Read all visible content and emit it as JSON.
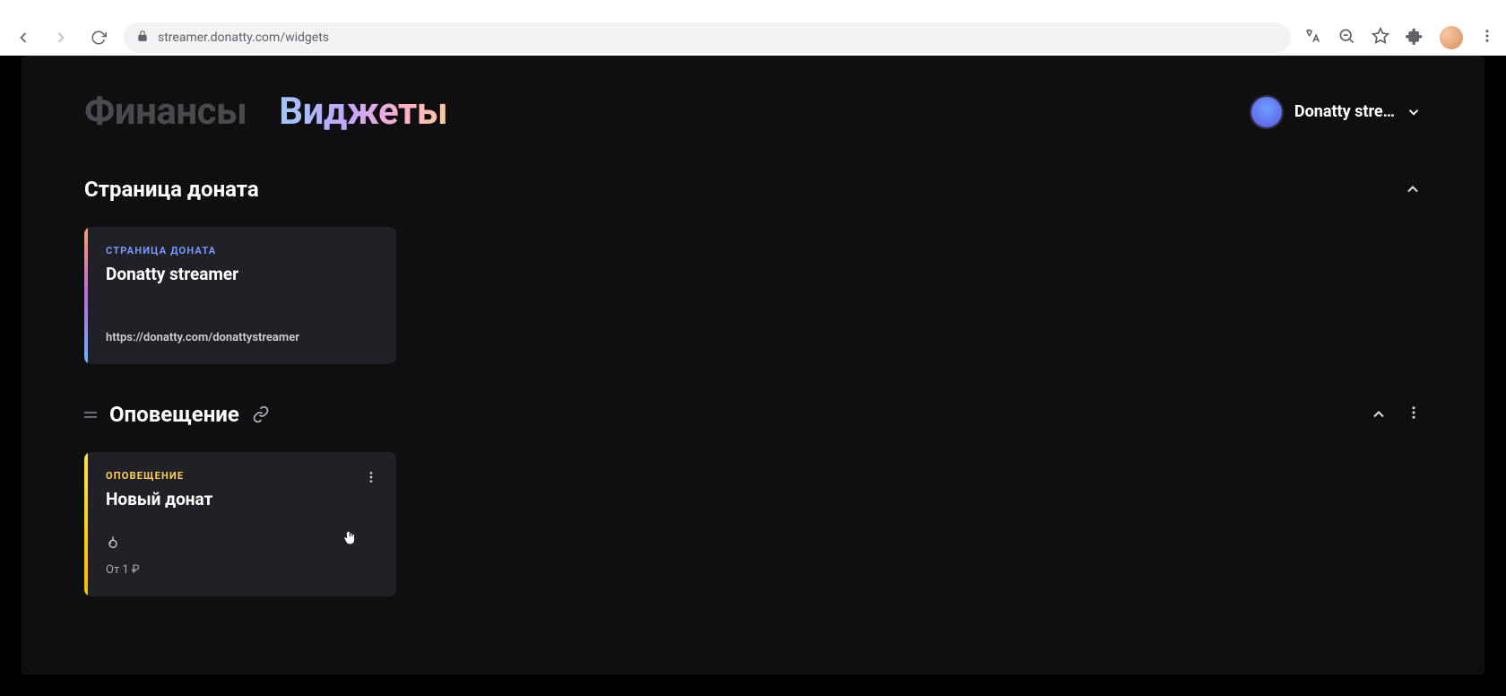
{
  "browser": {
    "url": "streamer.donatty.com/widgets"
  },
  "header": {
    "tab_finance": "Финансы",
    "tab_widgets": "Виджеты",
    "account_name": "Donatty stre…"
  },
  "sections": {
    "donation_page": {
      "title": "Страница доната",
      "card_label": "СТРАНИЦА ДОНАТА",
      "card_title": "Donatty streamer",
      "card_url": "https://donatty.com/donattystreamer"
    },
    "alert": {
      "title": "Оповещение",
      "card_label": "ОПОВЕЩЕНИЕ",
      "card_title": "Новый донат",
      "card_meta": "От 1 ₽"
    }
  }
}
